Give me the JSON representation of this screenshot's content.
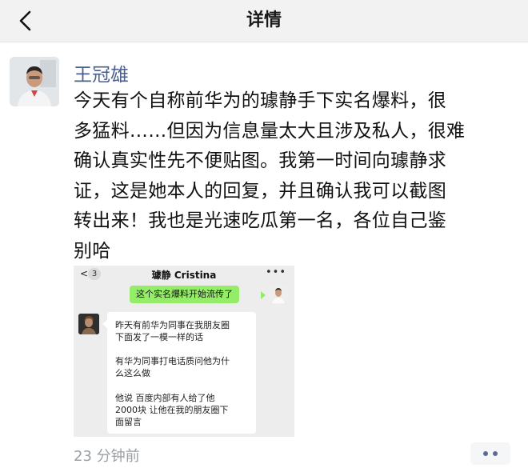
{
  "header": {
    "title": "详情",
    "back_icon": "chevron-left-icon"
  },
  "post": {
    "author": "王冠雄",
    "text_lines": [
      "今天有个自称前华为的璩静手下实名爆料，很",
      "多猛料……但因为信息量太大且涉及私人，很难",
      "确认真实性先不便贴图。我第一时间向璩静求",
      "证，这是她本人的回复，并且确认我可以截图",
      "转出来！我也是光速吃瓜第一名，各位自己鉴",
      "别哈"
    ],
    "timestamp": "23 分钟前",
    "more_icon": "more-dots-icon"
  },
  "embedded_chat": {
    "back_glyph": "<",
    "unread_count": "3",
    "contact_name": "璩静 Cristina",
    "more_glyph": "•••",
    "sent_message": "这个实名爆料开始流传了",
    "reply_lines": [
      "昨天有前华为同事在我朋友圈",
      "下面发了一模一样的话",
      "有华为同事打电话质问他为什",
      "么这么做",
      "他说  百度内部有人给了他",
      "2000块  让他在我的朋友圈下",
      "面留言"
    ]
  },
  "colors": {
    "author_link": "#4a5f8f",
    "wechat_green": "#95ec69",
    "timestamp_gray": "#9aa0a6"
  }
}
